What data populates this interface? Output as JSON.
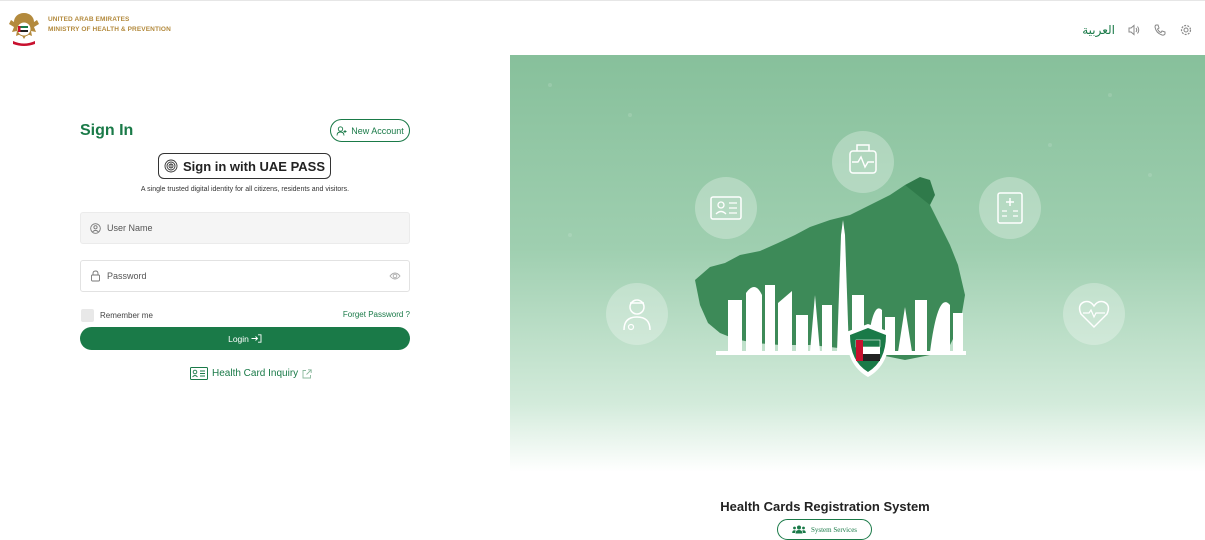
{
  "header": {
    "org_line1": "UNITED ARAB EMIRATES",
    "org_line2": "MINISTRY OF HEALTH & PREVENTION",
    "language": "العربية",
    "icons": [
      "speaker-icon",
      "phone-icon",
      "settings-icon"
    ]
  },
  "login": {
    "title": "Sign In",
    "new_account": "New Account",
    "uaepass_label": "Sign in with UAE PASS",
    "uaepass_desc": "A single trusted digital identity for all citizens, residents and visitors.",
    "username_placeholder": "User Name",
    "password_placeholder": "Password",
    "remember": "Remember me",
    "forget": "Forget Password ?",
    "login_button": "Login",
    "inquiry": "Health Card Inquiry"
  },
  "hero": {
    "title": "Health Cards Registration System",
    "services_button": "System Services"
  },
  "colors": {
    "primary": "#1a7a48",
    "gold": "#b38a3d",
    "hero_top": "#87c09b"
  }
}
